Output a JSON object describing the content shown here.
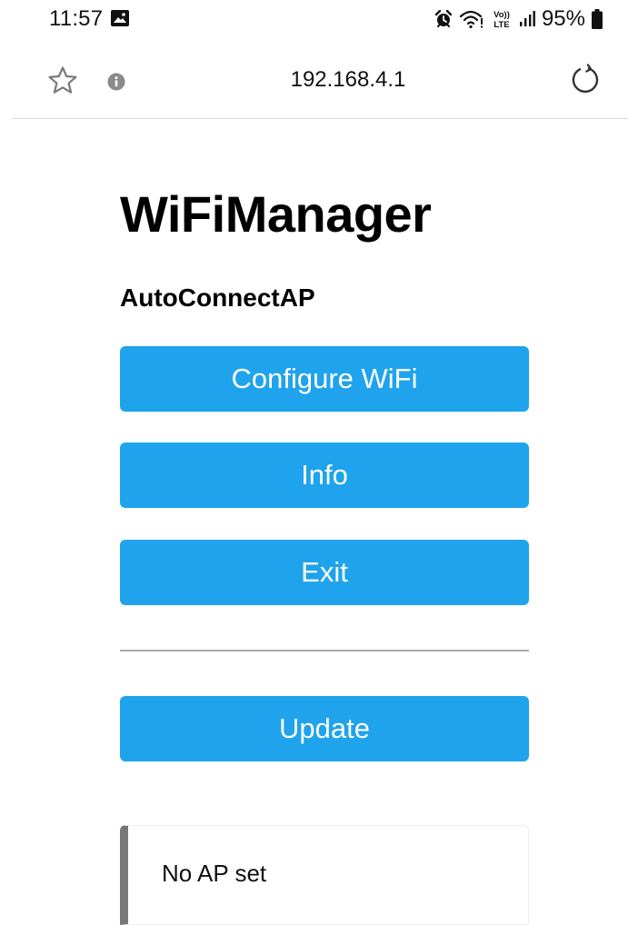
{
  "status_bar": {
    "time": "11:57",
    "battery": "95%",
    "icons": [
      "gallery-icon",
      "alarm-icon",
      "wifi-icon",
      "volte-icon",
      "signal-icon",
      "battery-icon"
    ],
    "volte_top": "Vo))",
    "volte_bottom": "LTE"
  },
  "browser": {
    "url": "192.168.4.1",
    "icons": [
      "star-icon",
      "info-icon",
      "reload-icon"
    ]
  },
  "page": {
    "title": "WiFiManager",
    "subtitle": "AutoConnectAP",
    "buttons": {
      "configure": "Configure WiFi",
      "info": "Info",
      "exit": "Exit",
      "update": "Update"
    },
    "message": "No AP set"
  },
  "colors": {
    "button": "#1fa3ec",
    "button_text": "#ffffff",
    "message_border": "#777777"
  }
}
